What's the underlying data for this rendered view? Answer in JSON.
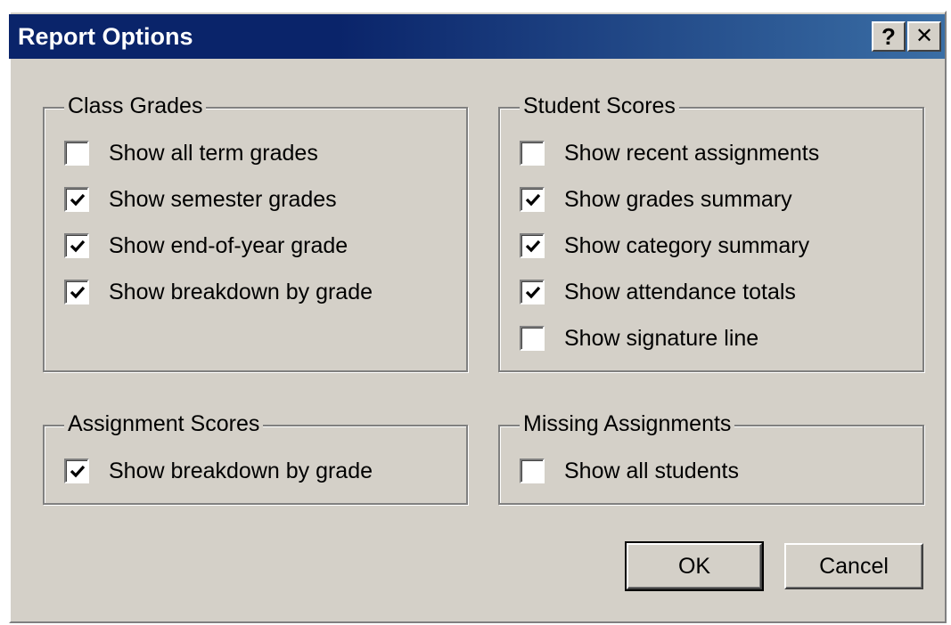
{
  "window": {
    "title": "Report Options",
    "help_glyph": "?",
    "close_glyph": "✕"
  },
  "groups": {
    "class_grades": {
      "legend": "Class Grades",
      "items": [
        {
          "label": "Show all term grades",
          "checked": false
        },
        {
          "label": "Show semester grades",
          "checked": true
        },
        {
          "label": "Show end-of-year grade",
          "checked": true
        },
        {
          "label": "Show breakdown by grade",
          "checked": true
        }
      ]
    },
    "student_scores": {
      "legend": "Student Scores",
      "items": [
        {
          "label": "Show recent assignments",
          "checked": false
        },
        {
          "label": "Show grades summary",
          "checked": true
        },
        {
          "label": "Show category summary",
          "checked": true
        },
        {
          "label": "Show attendance totals",
          "checked": true
        },
        {
          "label": "Show signature line",
          "checked": false
        }
      ]
    },
    "assignment_scores": {
      "legend": "Assignment Scores",
      "items": [
        {
          "label": "Show breakdown by grade",
          "checked": true
        }
      ]
    },
    "missing_assignments": {
      "legend": "Missing Assignments",
      "items": [
        {
          "label": "Show all students",
          "checked": false
        }
      ]
    }
  },
  "buttons": {
    "ok": "OK",
    "cancel": "Cancel"
  },
  "colors": {
    "dialog_face": "#d4d0c8",
    "titlebar_start": "#0a246a",
    "titlebar_end": "#3a6ea5"
  }
}
